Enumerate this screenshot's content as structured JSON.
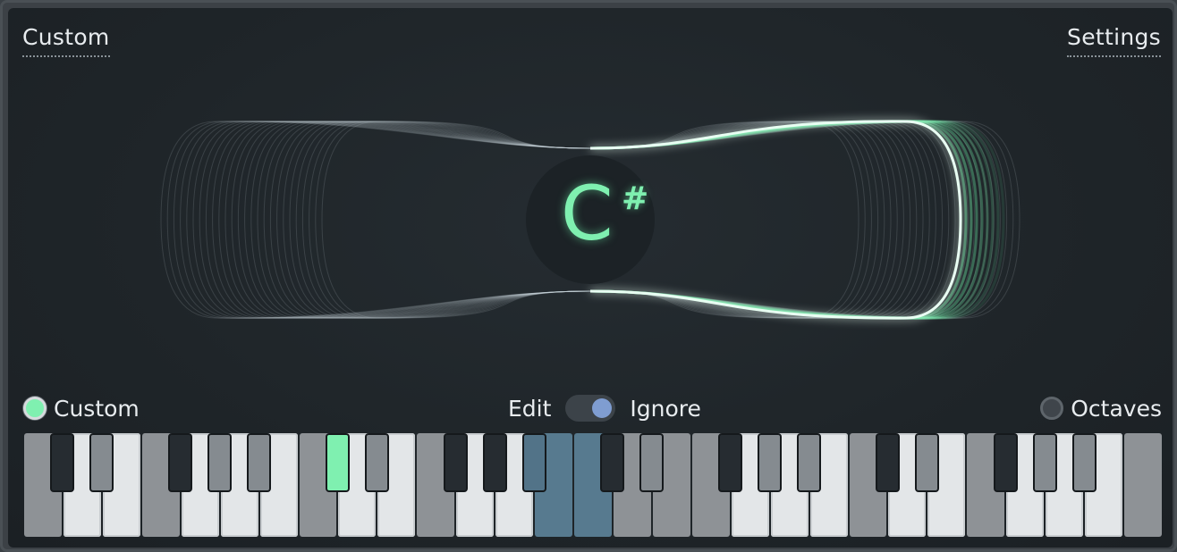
{
  "header": {
    "left_link": "Custom",
    "right_link": "Settings"
  },
  "tuner": {
    "note_letter": "C",
    "note_accidental": "#"
  },
  "controls": {
    "custom_radio_label": "Custom",
    "custom_radio_selected": true,
    "toggle_left_label": "Edit",
    "toggle_right_label": "Ignore",
    "toggle_state": "Ignore",
    "octaves_label": "Octaves",
    "octaves_selected": false
  },
  "colors": {
    "accent_green": "#7ff0b0",
    "selection_blue": "#577a8f",
    "toggle_knob": "#7f9dd1"
  },
  "keyboard": {
    "white_keys": [
      "gray",
      "light",
      "light",
      "gray",
      "light",
      "light",
      "light",
      "gray",
      "light",
      "light",
      "gray",
      "light",
      "light",
      "blue",
      "blue",
      "gray",
      "gray",
      "gray",
      "light",
      "light",
      "light",
      "gray",
      "light",
      "light",
      "gray",
      "light",
      "light",
      "light",
      "gray"
    ],
    "black_keys": [
      "dark",
      "mid",
      "dark",
      "mid",
      "mid",
      "green",
      "mid",
      "dark",
      "dark",
      "blue",
      "dark",
      "mid",
      "dark",
      "mid",
      "mid",
      "dark",
      "mid",
      "dark",
      "mid",
      "mid"
    ]
  }
}
